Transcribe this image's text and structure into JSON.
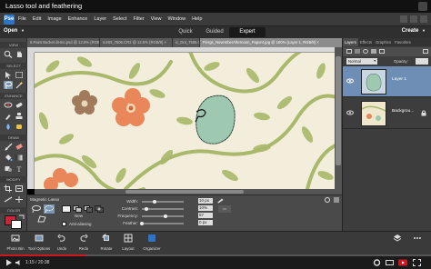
{
  "video": {
    "title": "Lasso tool and feathering",
    "time": "1:15 / 20:38",
    "progress": 0.2
  },
  "app": {
    "menu": [
      "File",
      "Edit",
      "Image",
      "Enhance",
      "Layer",
      "Select",
      "Filter",
      "View",
      "Window",
      "Help"
    ],
    "open_label": "Open",
    "modes": [
      {
        "label": "Quick"
      },
      {
        "label": "Guided"
      },
      {
        "label": "Expert"
      }
    ],
    "active_mode": "Expert",
    "create_label": "Create"
  },
  "documents": [
    "6.Paint Bucket demo.psd @ 12.5% (RGB/8) ×",
    "Ic493_7506.CR2 @ 12.5% (RGB/8) ×",
    "ic_Dot_7506.CR2 @ 12.5% (RGB/8) ×",
    "Flergs_NovemberAfternoon_Paper4.jpg @ 100% (Layer 1, RGB/8) ×"
  ],
  "toolbox": {
    "sections": [
      "VIEW",
      "SELECT",
      "ENHANCE",
      "DRAW",
      "MODIFY",
      "COLOR"
    ]
  },
  "options": {
    "tool_name": "Magnetic Lasso",
    "new_label": "New",
    "width_label": "Width:",
    "width_value": "10 px",
    "contrast_label": "Contrast:",
    "contrast_value": "10%",
    "frequency_label": "Frequency:",
    "frequency_value": "57",
    "feather_label": "Feather:",
    "feather_value": "0 px",
    "antialias_label": "Anti-aliasing",
    "width_level": 0.3,
    "contrast_level": 0.1,
    "frequency_level": 0.57,
    "feather_level": 0
  },
  "panel": {
    "tabs": [
      "Layers",
      "Effects",
      "Graphics",
      "Favorites"
    ],
    "mode_value": "Normal",
    "opacity_label": "Opacity:",
    "layers": [
      {
        "name": "Layer 1"
      },
      {
        "name": "Backgrou..."
      }
    ]
  },
  "bottom_bar": [
    "Photo Bin",
    "Tool Options",
    "Undo",
    "Redo",
    "Rotate",
    "Layout",
    "Organizer"
  ],
  "colors": {
    "accent": "#2b74c8",
    "selected_layer": "#6f8eb6",
    "yt_red": "#cc181e",
    "flower": "#e9875a",
    "leaf": "#a9b86a"
  }
}
